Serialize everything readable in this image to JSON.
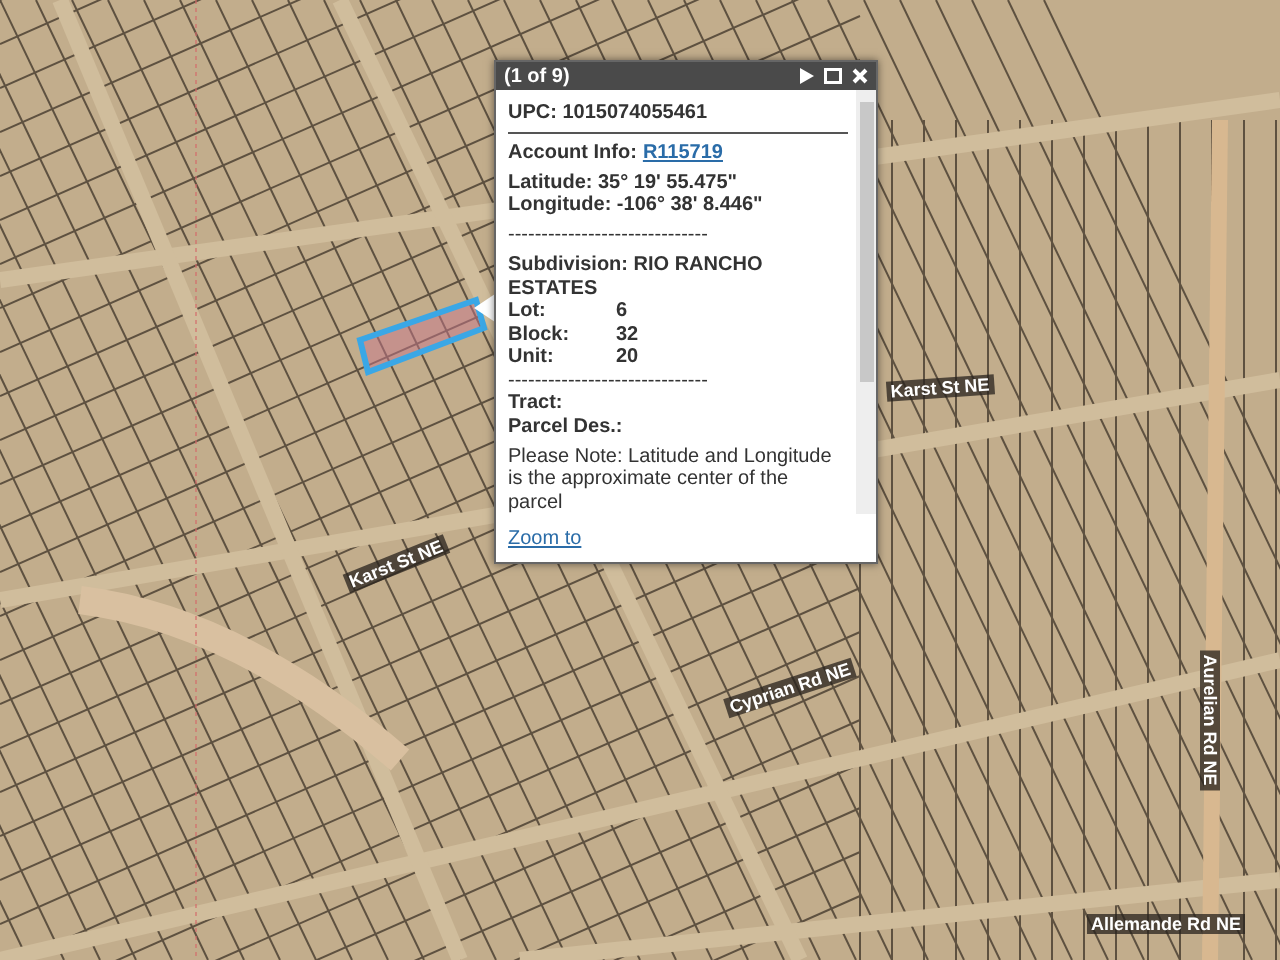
{
  "map": {
    "street_labels": [
      {
        "text": "Karst St NE"
      },
      {
        "text": "Karst St NE"
      },
      {
        "text": "Cyprian Rd NE"
      },
      {
        "text": "Aurelian Rd NE"
      },
      {
        "text": "Allemande Rd NE"
      }
    ]
  },
  "popup": {
    "counter": "(1 of 9)",
    "content": [
      {
        "kind": "heading",
        "text": "UPC: 1015074055461"
      },
      {
        "kind": "link",
        "label": "Account Info:",
        "value": "R115719"
      },
      {
        "kind": "gap"
      },
      {
        "kind": "text",
        "text": "Latitude: 35° 19' 55.475\""
      },
      {
        "kind": "text",
        "text": "Longitude: -106° 38' 8.446\""
      },
      {
        "kind": "gap"
      },
      {
        "kind": "dashes",
        "text": "------------------------------"
      },
      {
        "kind": "gap"
      },
      {
        "kind": "text",
        "text": "Subdivision: RIO RANCHO ESTATES"
      },
      {
        "kind": "pair",
        "label": "Lot:",
        "value": "6"
      },
      {
        "kind": "pair",
        "label": "Block:",
        "value": "32"
      },
      {
        "kind": "pair",
        "label": "Unit:",
        "value": "20"
      },
      {
        "kind": "dashes",
        "text": "------------------------------"
      },
      {
        "kind": "text",
        "text": "Tract:"
      },
      {
        "kind": "text",
        "text": "Parcel Des.:"
      },
      {
        "kind": "gap"
      },
      {
        "kind": "note",
        "text": "Please Note: Latitude and Longitude is the approximate center of the parcel"
      }
    ],
    "zoom_link": "Zoom to"
  }
}
